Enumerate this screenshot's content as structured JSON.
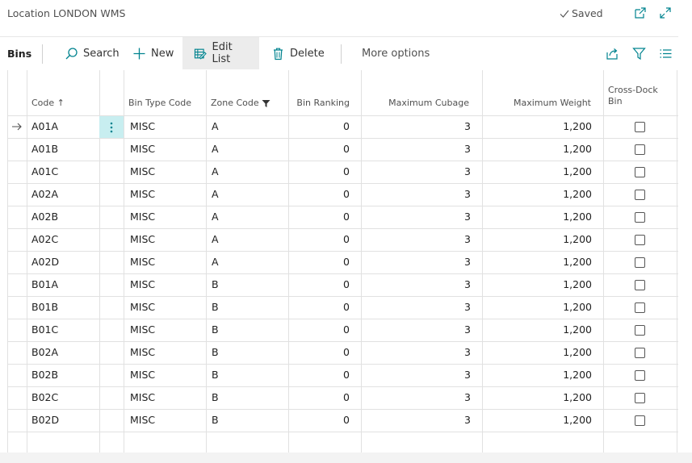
{
  "window": {
    "title": "Location LONDON WMS",
    "saved_label": "Saved",
    "icons": [
      "checkmark-icon",
      "open-in-new-window-icon",
      "expand-icon"
    ]
  },
  "actionbar": {
    "tab_label": "Bins",
    "search_label": "Search",
    "new_label": "New",
    "edit_list_label": "Edit List",
    "delete_label": "Delete",
    "more_label": "More options",
    "right_icons": [
      "share-icon",
      "filter-icon",
      "list-view-icon"
    ]
  },
  "columns": {
    "code": "Code",
    "code_sort_indicator": "↑",
    "bin_type_code": "Bin Type Code",
    "zone_code": "Zone Code",
    "bin_ranking": "Bin Ranking",
    "maximum_cubage": "Maximum Cubage",
    "maximum_weight": "Maximum Weight",
    "cross_dock_line1": "Cross-Dock",
    "cross_dock_line2": "Bin"
  },
  "rows": [
    {
      "code": "A01A",
      "bin_type": "MISC",
      "zone": "A",
      "ranking": "0",
      "cubage": "3",
      "weight": "1,200",
      "cross_dock": false
    },
    {
      "code": "A01B",
      "bin_type": "MISC",
      "zone": "A",
      "ranking": "0",
      "cubage": "3",
      "weight": "1,200",
      "cross_dock": false
    },
    {
      "code": "A01C",
      "bin_type": "MISC",
      "zone": "A",
      "ranking": "0",
      "cubage": "3",
      "weight": "1,200",
      "cross_dock": false
    },
    {
      "code": "A02A",
      "bin_type": "MISC",
      "zone": "A",
      "ranking": "0",
      "cubage": "3",
      "weight": "1,200",
      "cross_dock": false
    },
    {
      "code": "A02B",
      "bin_type": "MISC",
      "zone": "A",
      "ranking": "0",
      "cubage": "3",
      "weight": "1,200",
      "cross_dock": false
    },
    {
      "code": "A02C",
      "bin_type": "MISC",
      "zone": "A",
      "ranking": "0",
      "cubage": "3",
      "weight": "1,200",
      "cross_dock": false
    },
    {
      "code": "A02D",
      "bin_type": "MISC",
      "zone": "A",
      "ranking": "0",
      "cubage": "3",
      "weight": "1,200",
      "cross_dock": false
    },
    {
      "code": "B01A",
      "bin_type": "MISC",
      "zone": "B",
      "ranking": "0",
      "cubage": "3",
      "weight": "1,200",
      "cross_dock": false
    },
    {
      "code": "B01B",
      "bin_type": "MISC",
      "zone": "B",
      "ranking": "0",
      "cubage": "3",
      "weight": "1,200",
      "cross_dock": false
    },
    {
      "code": "B01C",
      "bin_type": "MISC",
      "zone": "B",
      "ranking": "0",
      "cubage": "3",
      "weight": "1,200",
      "cross_dock": false
    },
    {
      "code": "B02A",
      "bin_type": "MISC",
      "zone": "B",
      "ranking": "0",
      "cubage": "3",
      "weight": "1,200",
      "cross_dock": false
    },
    {
      "code": "B02B",
      "bin_type": "MISC",
      "zone": "B",
      "ranking": "0",
      "cubage": "3",
      "weight": "1,200",
      "cross_dock": false
    },
    {
      "code": "B02C",
      "bin_type": "MISC",
      "zone": "B",
      "ranking": "0",
      "cubage": "3",
      "weight": "1,200",
      "cross_dock": false
    },
    {
      "code": "B02D",
      "bin_type": "MISC",
      "zone": "B",
      "ranking": "0",
      "cubage": "3",
      "weight": "1,200",
      "cross_dock": false
    }
  ],
  "selected_row": 0,
  "colors": {
    "accent": "#00838f",
    "selected_cell": "#c8eef0",
    "active_button_bg": "#ececec",
    "grid_line": "#e1e1e1"
  }
}
